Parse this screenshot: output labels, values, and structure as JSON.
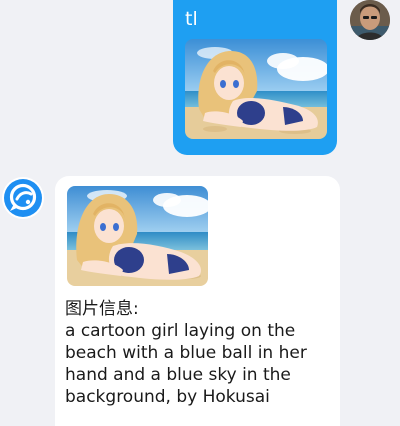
{
  "messages": [
    {
      "direction": "outgoing",
      "text": "tl",
      "image_icon": "anime-beach-image",
      "avatar_icon": "user-avatar-photo"
    },
    {
      "direction": "incoming",
      "image_icon": "anime-beach-image",
      "info_label": "图片信息:",
      "info_text": "a cartoon girl laying on the beach with a blue ball in her hand and a blue sky in the background, by Hokusai",
      "avatar_icon": "bot-logo-icon"
    }
  ],
  "colors": {
    "background": "#f0f1f5",
    "outgoing_bubble": "#1e9ff2",
    "incoming_bubble": "#ffffff",
    "bot_logo": "#1e8ff2"
  }
}
